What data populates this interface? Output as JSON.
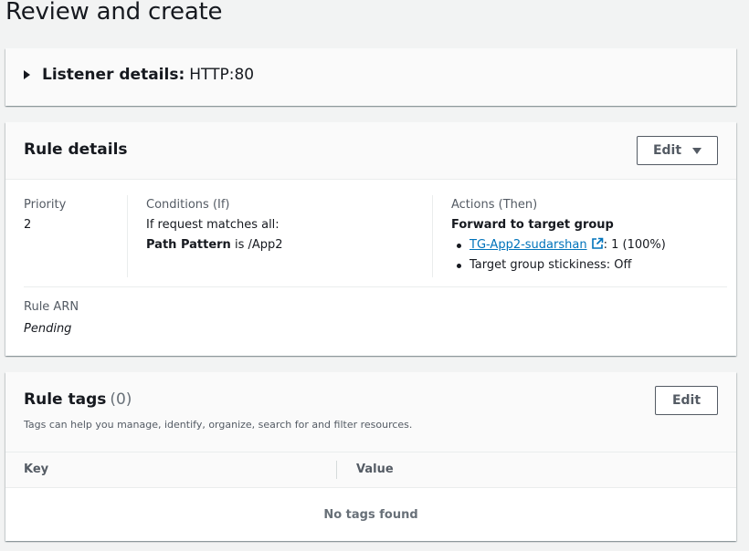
{
  "page": {
    "title": "Review and create"
  },
  "listener": {
    "label": "Listener details:",
    "value": "HTTP:80"
  },
  "rule": {
    "title": "Rule details",
    "edit_label": "Edit",
    "priority": {
      "label": "Priority",
      "value": "2"
    },
    "conditions": {
      "label": "Conditions (If)",
      "match_text": "If request matches all:",
      "pattern_label": "Path Pattern",
      "pattern_operator": "is",
      "pattern_value": "/App2"
    },
    "actions": {
      "label": "Actions (Then)",
      "forward_label": "Forward to target group",
      "target_group_name": "TG-App2-sudarshan",
      "target_group_weight": ": 1 (100%)",
      "stickiness": "Target group stickiness: Off"
    },
    "arn": {
      "label": "Rule ARN",
      "value": "Pending"
    }
  },
  "tags": {
    "title": "Rule tags",
    "count": "(0)",
    "description": "Tags can help you manage, identify, organize, search for and filter resources.",
    "edit_label": "Edit",
    "columns": [
      "Key",
      "Value"
    ],
    "empty_text": "No tags found"
  },
  "colors": {
    "link": "#0073bb",
    "text": "#16191f",
    "muted": "#545b64",
    "background": "#f2f3f3"
  }
}
